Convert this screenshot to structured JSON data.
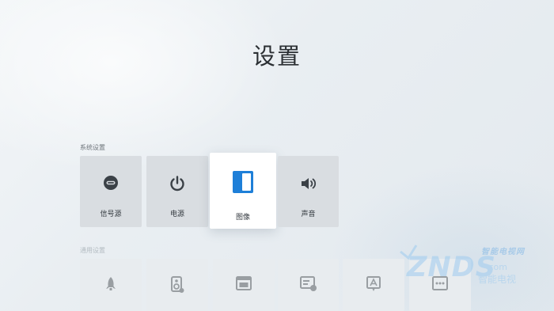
{
  "page": {
    "title": "设置"
  },
  "system_section": {
    "label": "系统设置",
    "tiles": [
      {
        "label": "信号源",
        "icon": "input-source-icon",
        "focused": false
      },
      {
        "label": "电源",
        "icon": "power-icon",
        "focused": false
      },
      {
        "label": "图像",
        "icon": "picture-icon",
        "focused": true
      },
      {
        "label": "声音",
        "icon": "speaker-icon",
        "focused": false
      }
    ]
  },
  "general_section": {
    "label": "通用设置",
    "tiles": [
      {
        "icon": "rocket-icon"
      },
      {
        "icon": "storage-icon"
      },
      {
        "icon": "window-icon"
      },
      {
        "icon": "network-icon"
      },
      {
        "icon": "font-icon"
      },
      {
        "icon": "more-icon"
      }
    ]
  },
  "watermark": {
    "line1": "智能电视网",
    "brand": "ZNDS",
    "line2": "·com",
    "line3": "智能电视"
  },
  "colors": {
    "accent": "#1e7fd8",
    "icon_gray": "#3b4147",
    "tile_bg": "#d9dde1",
    "focused_bg": "#ffffff"
  }
}
